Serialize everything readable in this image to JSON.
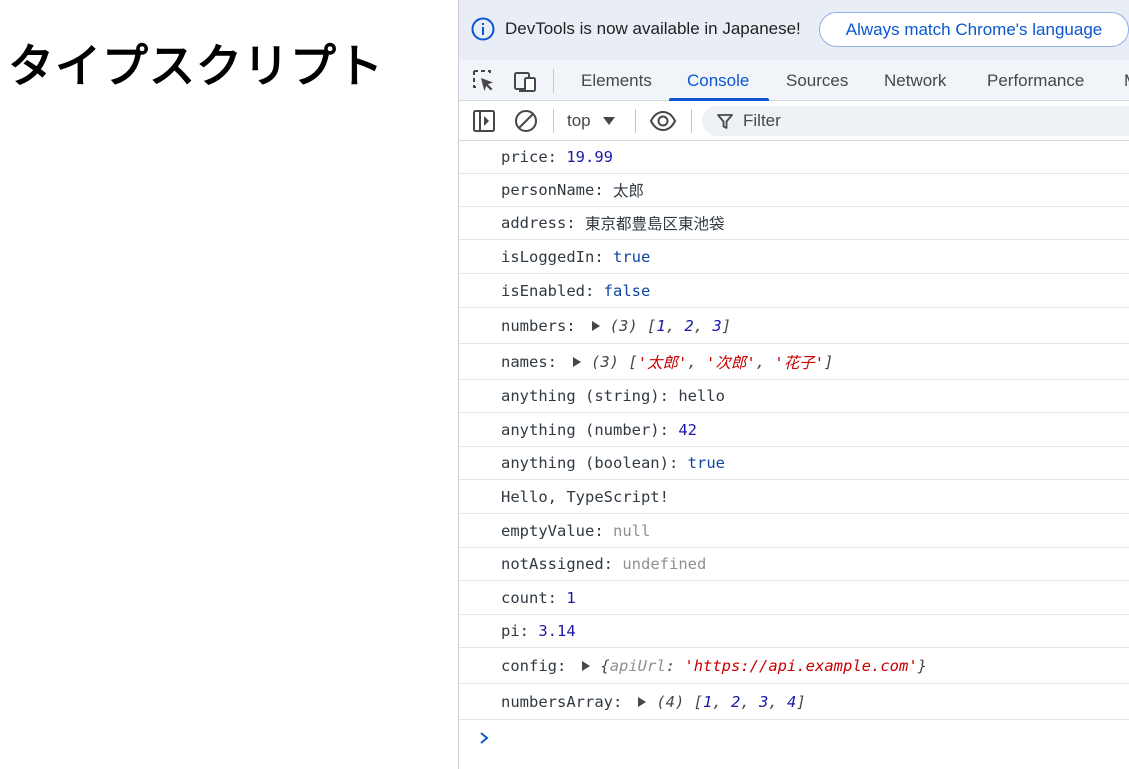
{
  "page": {
    "heading": "タイプスクリプト"
  },
  "banner": {
    "message": "DevTools is now available in Japanese!",
    "button_label": "Always match Chrome's language"
  },
  "tabs": [
    {
      "label": "Elements"
    },
    {
      "label": "Console"
    },
    {
      "label": "Sources"
    },
    {
      "label": "Network"
    },
    {
      "label": "Performance"
    },
    {
      "label": "M"
    }
  ],
  "active_tab": "Console",
  "toolbar": {
    "context": "top",
    "filter_placeholder": "Filter"
  },
  "colors": {
    "accent": "#0b57d0",
    "banner_bg": "#e9eef6",
    "string": "#c80000",
    "number": "#1a1aa6",
    "null": "#909090"
  },
  "console": {
    "lines": [
      {
        "key": "price",
        "value": "19.99",
        "type": "number"
      },
      {
        "key": "personName",
        "value": "太郎",
        "type": "text"
      },
      {
        "key": "address",
        "value": "東京都豊島区東池袋",
        "type": "text"
      },
      {
        "key": "isLoggedIn",
        "value": "true",
        "type": "boolean"
      },
      {
        "key": "isEnabled",
        "value": "false",
        "type": "boolean"
      },
      {
        "key": "numbers",
        "count": "(3)",
        "items": [
          "1",
          "2",
          "3"
        ],
        "type": "number-array"
      },
      {
        "key": "names",
        "count": "(3)",
        "items": [
          "'太郎'",
          "'次郎'",
          "'花子'"
        ],
        "type": "string-array"
      },
      {
        "key": "anything (string)",
        "value": "hello",
        "type": "text"
      },
      {
        "key": "anything (number)",
        "value": "42",
        "type": "number"
      },
      {
        "key": "anything (boolean)",
        "value": "true",
        "type": "boolean"
      },
      {
        "text": "Hello, TypeScript!",
        "type": "plain"
      },
      {
        "key": "emptyValue",
        "value": "null",
        "type": "null"
      },
      {
        "key": "notAssigned",
        "value": "undefined",
        "type": "null"
      },
      {
        "key": "count",
        "value": "1",
        "type": "number"
      },
      {
        "key": "pi",
        "value": "3.14",
        "type": "number"
      },
      {
        "key": "config",
        "obj_key": "apiUrl",
        "obj_value": "'https://api.example.com'",
        "type": "object"
      },
      {
        "key": "numbersArray",
        "count": "(4)",
        "items": [
          "1",
          "2",
          "3",
          "4"
        ],
        "type": "number-array"
      }
    ]
  }
}
